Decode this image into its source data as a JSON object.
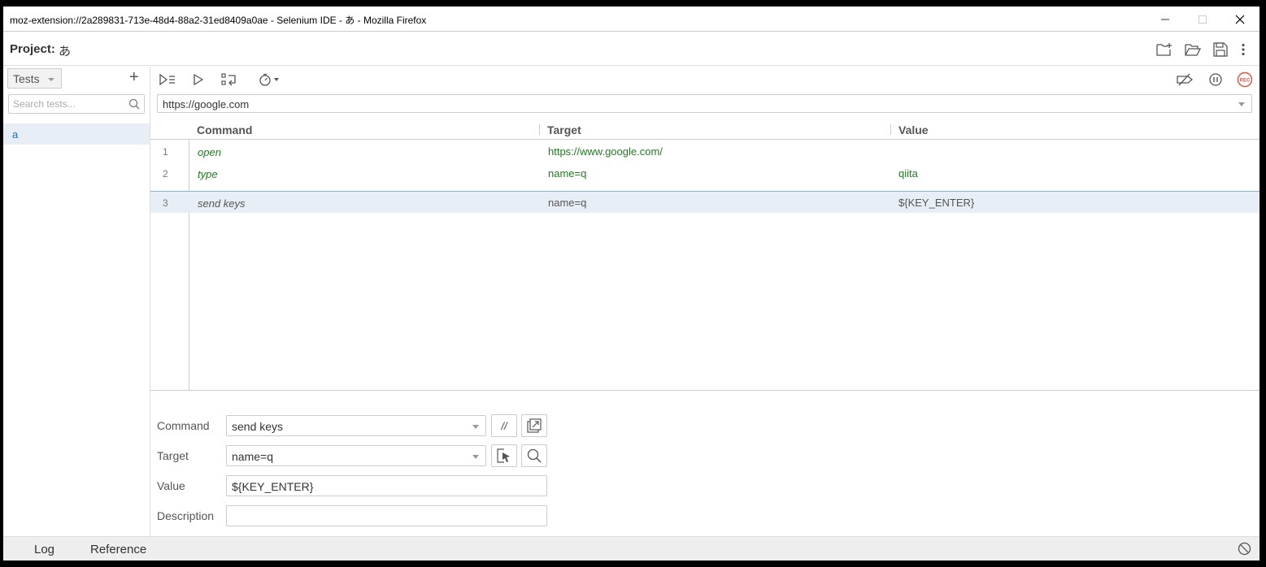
{
  "window": {
    "title": "moz-extension://2a289831-713e-48d4-88a2-31ed8409a0ae - Selenium IDE - あ - Mozilla Firefox"
  },
  "project": {
    "label": "Project:",
    "name": "あ"
  },
  "sidebar": {
    "dropdown_label": "Tests",
    "add_label": "+",
    "search_placeholder": "Search tests...",
    "tests": [
      {
        "name": "a"
      }
    ]
  },
  "main": {
    "base_url": "https://google.com",
    "columns": {
      "command": "Command",
      "target": "Target",
      "value": "Value"
    },
    "rows": [
      {
        "num": "1",
        "command": "open",
        "target": "https://www.google.com/",
        "value": ""
      },
      {
        "num": "2",
        "command": "type",
        "target": "name=q",
        "value": "qiita"
      },
      {
        "num": "3",
        "command": "send keys",
        "target": "name=q",
        "value": "${KEY_ENTER}"
      }
    ],
    "selected_row": 3
  },
  "editor": {
    "command_label": "Command",
    "command_value": "send keys",
    "comment_button": "//",
    "target_label": "Target",
    "target_value": "name=q",
    "value_label": "Value",
    "value_value": "${KEY_ENTER}",
    "description_label": "Description",
    "description_value": ""
  },
  "bottom": {
    "tabs": [
      "Log",
      "Reference"
    ],
    "active_tab": "Log"
  },
  "colors": {
    "accent": "#2a6bb0",
    "command_green": "#207e20",
    "rec_red": "#e74c3c",
    "selected_row_bg": "#e8eef5"
  },
  "icons": [
    "close-icon",
    "minimize-icon",
    "maximize-icon",
    "new-project-icon",
    "open-project-icon",
    "save-project-icon",
    "more-options-icon",
    "run-all-icon",
    "run-icon",
    "step-icon",
    "speed-icon",
    "disable-breakpoints-icon",
    "pause-icon",
    "record-icon",
    "search-icon",
    "select-target-icon",
    "find-target-icon",
    "open-reference-icon",
    "clear-log-icon"
  ]
}
